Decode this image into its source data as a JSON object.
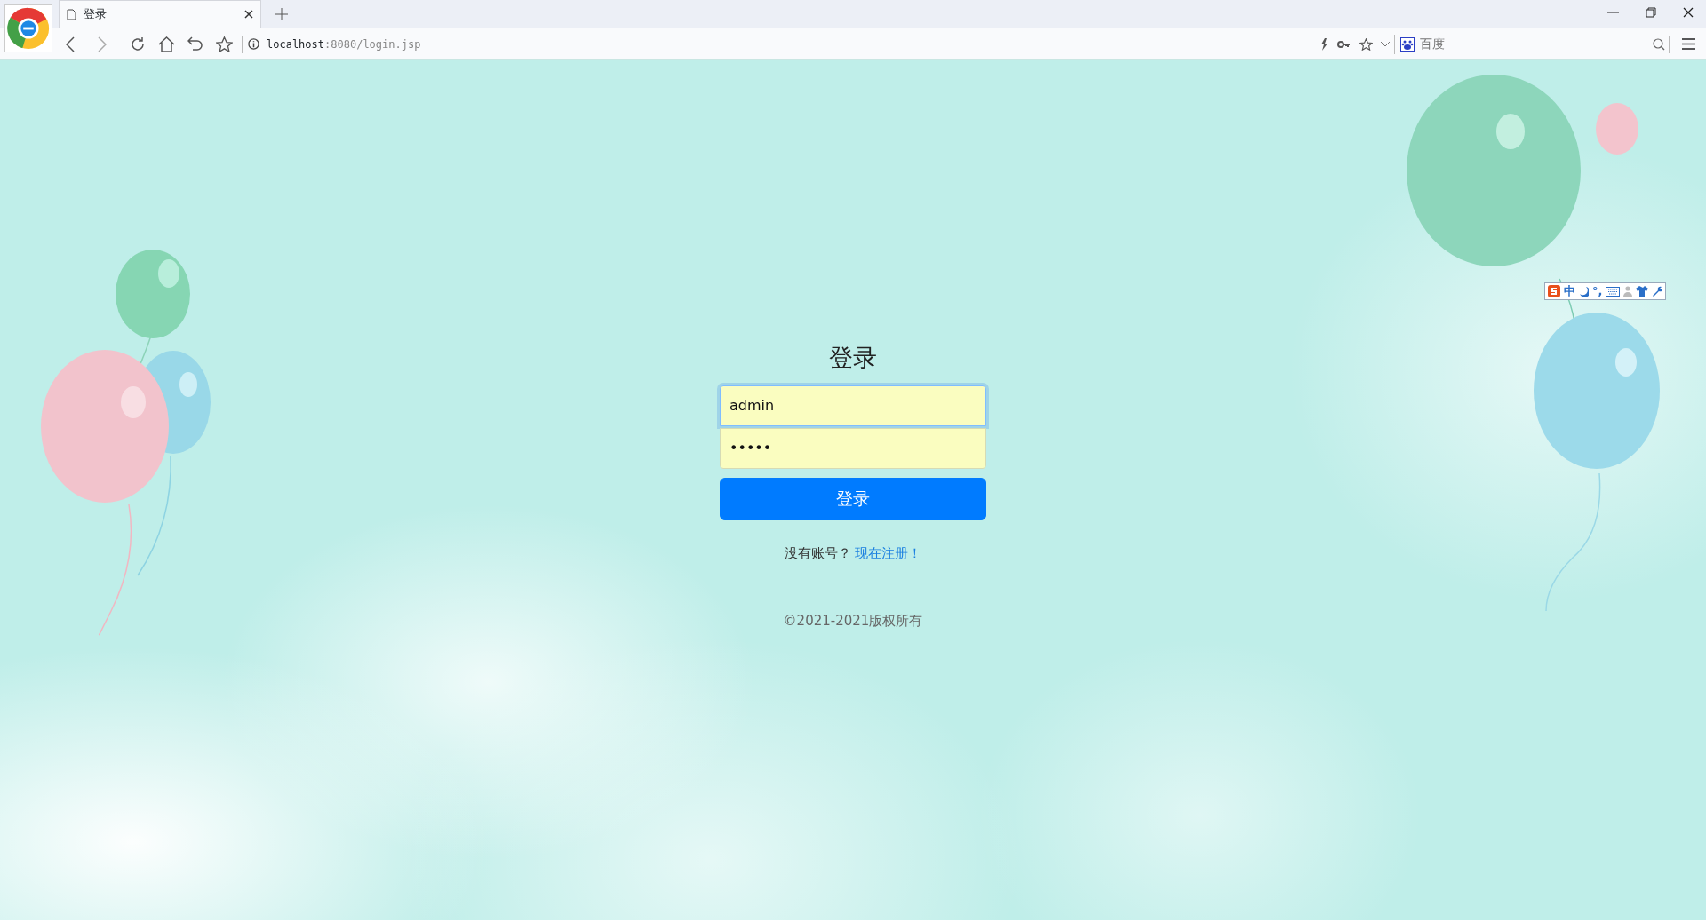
{
  "browser": {
    "tab": {
      "title": "登录",
      "selected": true
    },
    "address": {
      "host": "localhost",
      "path": ":8080/login.jsp"
    },
    "search": {
      "placeholder": "百度"
    }
  },
  "login": {
    "title": "登录",
    "username": {
      "value": "admin",
      "focused": true
    },
    "password": {
      "value": "•••••"
    },
    "submit": "登录",
    "register_prompt": "没有账号？",
    "register_link": "现在注册！"
  },
  "footer": "©2021-2021版权所有",
  "ime_toolbar": {
    "mode": "中",
    "punctuation": "°,"
  }
}
